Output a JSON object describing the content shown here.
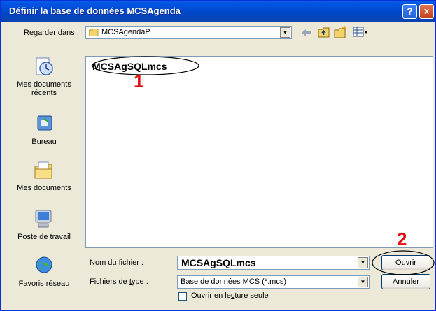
{
  "window": {
    "title": "Définir la base de données MCSAgenda",
    "help": "?",
    "close": "×"
  },
  "look_in": {
    "label": "Regarder dans :",
    "value": "MCSAgendaP"
  },
  "places": [
    {
      "label": "Mes documents récents"
    },
    {
      "label": "Bureau"
    },
    {
      "label": "Mes documents"
    },
    {
      "label": "Poste de travail"
    },
    {
      "label": "Favoris réseau"
    }
  ],
  "files": [
    {
      "name": "MCSAgSQLmcs"
    }
  ],
  "filename": {
    "label": "Nom du fichier :",
    "value": "MCSAgSQLmcs"
  },
  "filetype": {
    "label": "Fichiers de type :",
    "value": "Base de données MCS (*.mcs)"
  },
  "readonly": {
    "label": "Ouvrir en lecture seule",
    "checked": false
  },
  "buttons": {
    "open": "Ouvrir",
    "cancel": "Annuler"
  },
  "annotations": {
    "one": "1",
    "two": "2"
  },
  "colors": {
    "annotation": "#e01010",
    "titlebar": "#0054E3"
  },
  "icons": [
    "back-arrow-icon",
    "up-folder-icon",
    "new-folder-icon",
    "view-menu-icon"
  ]
}
